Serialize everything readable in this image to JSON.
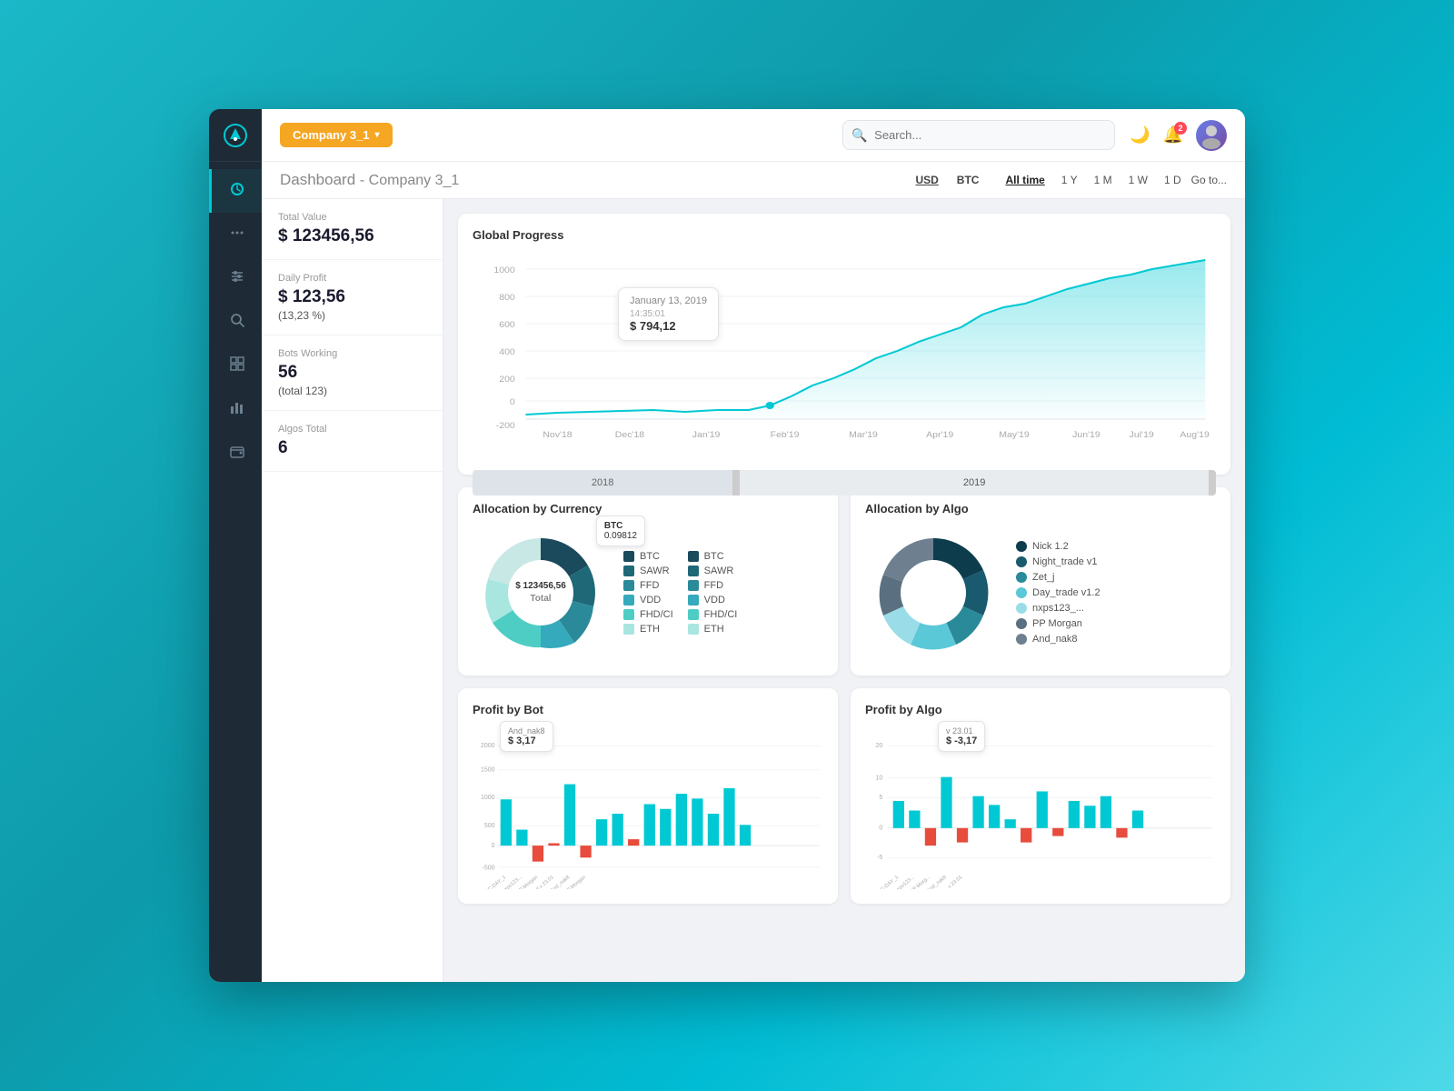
{
  "sidebar": {
    "logo": "★",
    "items": [
      {
        "id": "dashboard",
        "icon": "⊙",
        "active": true
      },
      {
        "id": "menu",
        "icon": "···"
      },
      {
        "id": "filters",
        "icon": "⚙"
      },
      {
        "id": "search",
        "icon": "🔍"
      },
      {
        "id": "table",
        "icon": "▦"
      },
      {
        "id": "chart",
        "icon": "📈"
      },
      {
        "id": "wallet",
        "icon": "💼"
      }
    ]
  },
  "topnav": {
    "company": "Company 3_1",
    "search_placeholder": "Search...",
    "bell_count": "2"
  },
  "page_header": {
    "title": "Dashboard",
    "subtitle": "Company 3_1",
    "currencies": [
      "USD",
      "BTC"
    ],
    "active_currency": "USD",
    "time_filters": [
      "All time",
      "1 Y",
      "1 M",
      "1 W",
      "1 D"
    ],
    "active_time": "All time",
    "goto_label": "Go to..."
  },
  "metrics": [
    {
      "label": "Total Value",
      "value": "$ 123456,56",
      "sub": ""
    },
    {
      "label": "Daily Profit",
      "value": "$ 123,56",
      "sub": "(13,23 %)"
    },
    {
      "label": "Bots Working",
      "value": "56",
      "sub": "(total 123)"
    },
    {
      "label": "Algos Total",
      "value": "6",
      "sub": ""
    }
  ],
  "global_progress": {
    "title": "Global Progress",
    "tooltip": {
      "date": "January 13, 2019",
      "time": "14:35:01",
      "value": "$ 794,12"
    },
    "y_labels": [
      "1000",
      "800",
      "600",
      "400",
      "200",
      "0",
      "-200"
    ],
    "x_labels": [
      "Nov'18",
      "Dec'18",
      "Jan'19",
      "Feb'19",
      "Mar'19",
      "Apr'19",
      "May'19",
      "Jun'19",
      "Jul'19",
      "Aug'19"
    ],
    "range_labels": [
      "2018",
      "2019"
    ]
  },
  "allocation_currency": {
    "title": "Allocation by Currency",
    "center_text": "$ 123456,56\nTotal",
    "tooltip_label": "BTC",
    "tooltip_value": "0.09812",
    "legend": [
      {
        "label": "BTC",
        "color": "#1a4a5c"
      },
      {
        "label": "SAWR",
        "color": "#1e6878"
      },
      {
        "label": "FFD",
        "color": "#2a8a9a"
      },
      {
        "label": "VDD",
        "color": "#35aabc"
      },
      {
        "label": "FHD/CI",
        "color": "#4ecdc4"
      },
      {
        "label": "ETH",
        "color": "#a8e6df"
      },
      {
        "label": "BTC",
        "color": "#1a4a5c"
      },
      {
        "label": "SAWR",
        "color": "#1e6878"
      },
      {
        "label": "FFD",
        "color": "#2a8a9a"
      },
      {
        "label": "VDD",
        "color": "#35aabc"
      },
      {
        "label": "FHD/CI",
        "color": "#4ecdc4"
      },
      {
        "label": "ETH",
        "color": "#a8e6df"
      }
    ],
    "donut_segments": [
      {
        "pct": 30,
        "color": "#1a4a5c"
      },
      {
        "pct": 15,
        "color": "#1e6878"
      },
      {
        "pct": 12,
        "color": "#2a8a9a"
      },
      {
        "pct": 10,
        "color": "#35aabc"
      },
      {
        "pct": 18,
        "color": "#4ecdc4"
      },
      {
        "pct": 8,
        "color": "#a8e6df"
      },
      {
        "pct": 7,
        "color": "#c8e8e5"
      }
    ]
  },
  "allocation_algo": {
    "title": "Allocation by Algo",
    "legend": [
      {
        "label": "Nick 1.2",
        "color": "#0d3d4d"
      },
      {
        "label": "Night_trade v1",
        "color": "#1a5a6e"
      },
      {
        "label": "Zet_j",
        "color": "#2a8a9a"
      },
      {
        "label": "Day_trade v1.2",
        "color": "#5bc8d8"
      },
      {
        "label": "nxps123_...",
        "color": "#9adde8"
      },
      {
        "label": "PP Morgan",
        "color": "#5a7080"
      },
      {
        "label": "And_nak8",
        "color": "#6e8090"
      }
    ],
    "donut_segments": [
      {
        "pct": 25,
        "color": "#0d3d4d"
      },
      {
        "pct": 20,
        "color": "#1a5a6e"
      },
      {
        "pct": 18,
        "color": "#2a8a9a"
      },
      {
        "pct": 15,
        "color": "#5bc8d8"
      },
      {
        "pct": 12,
        "color": "#9adde8"
      },
      {
        "pct": 6,
        "color": "#5a7080"
      },
      {
        "pct": 4,
        "color": "#6e8090"
      }
    ]
  },
  "profit_bot": {
    "title": "Profit by Bot",
    "tooltip_label": "And_nak8",
    "tooltip_value": "$ 3,17",
    "y_labels": [
      "2000",
      "1500",
      "1000",
      "500",
      "0",
      "-500"
    ],
    "bars": [
      {
        "h": 0.45,
        "neg": false
      },
      {
        "h": 0.15,
        "neg": false
      },
      {
        "h": 0.2,
        "neg": true
      },
      {
        "h": 0.05,
        "neg": true
      },
      {
        "h": 0.6,
        "neg": false
      },
      {
        "h": 0.08,
        "neg": true
      },
      {
        "h": 0.25,
        "neg": false
      },
      {
        "h": 0.3,
        "neg": false
      },
      {
        "h": 0.15,
        "neg": true
      },
      {
        "h": 0.4,
        "neg": false
      },
      {
        "h": 0.35,
        "neg": false
      },
      {
        "h": 0.5,
        "neg": false
      },
      {
        "h": 0.45,
        "neg": false
      },
      {
        "h": 0.3,
        "neg": false
      },
      {
        "h": 0.55,
        "neg": false
      },
      {
        "h": 0.2,
        "neg": false
      }
    ]
  },
  "profit_algo": {
    "title": "Profit by Algo",
    "tooltip_label": "v 23.01",
    "tooltip_value": "$ -3,17",
    "y_labels": [
      "20",
      "10",
      "5",
      "0",
      "-5"
    ],
    "bars": [
      {
        "h": 0.3,
        "neg": false
      },
      {
        "h": 0.2,
        "neg": false
      },
      {
        "h": 0.15,
        "neg": true
      },
      {
        "h": 0.5,
        "neg": false
      },
      {
        "h": 0.1,
        "neg": true
      },
      {
        "h": 0.35,
        "neg": false
      },
      {
        "h": 0.25,
        "neg": false
      },
      {
        "h": 0.1,
        "neg": false
      },
      {
        "h": 0.15,
        "neg": true
      },
      {
        "h": 0.4,
        "neg": false
      },
      {
        "h": 0.08,
        "neg": true
      },
      {
        "h": 0.3,
        "neg": false
      },
      {
        "h": 0.25,
        "neg": false
      },
      {
        "h": 0.35,
        "neg": false
      },
      {
        "h": 0.1,
        "neg": true
      },
      {
        "h": 0.2,
        "neg": false
      }
    ]
  }
}
